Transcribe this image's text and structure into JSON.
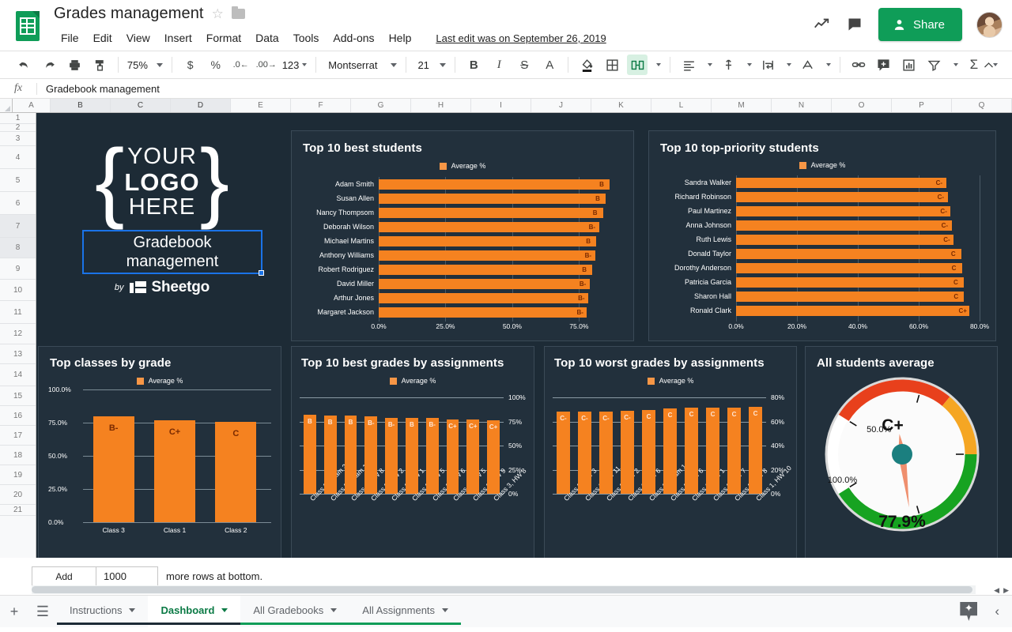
{
  "app": {
    "doc_title": "Grades management",
    "last_edit": "Last edit was on September 26, 2019",
    "share_label": "Share",
    "menus": [
      "File",
      "Edit",
      "View",
      "Insert",
      "Format",
      "Data",
      "Tools",
      "Add-ons",
      "Help"
    ],
    "icons": {
      "logo": "sheets-logo-icon",
      "star": "star-icon",
      "folder": "move-to-folder-icon",
      "activity": "activity-trend-icon",
      "comments": "comments-icon",
      "share_person": "person-add-icon",
      "avatar": "user-avatar"
    }
  },
  "toolbar": {
    "zoom": "75%",
    "font": "Montserrat",
    "font_size": "21",
    "number_format": "123",
    "buttons": [
      "undo-icon",
      "redo-icon",
      "print-icon",
      "paint-format-icon",
      "currency-icon",
      "percent-icon",
      "decrease-decimal-icon",
      "increase-decimal-icon",
      "bold-icon",
      "italic-icon",
      "strikethrough-icon",
      "text-color-icon",
      "fill-color-icon",
      "borders-icon",
      "merge-cells-icon",
      "horizontal-align-icon",
      "vertical-align-icon",
      "text-wrap-icon",
      "text-rotation-icon",
      "insert-link-icon",
      "insert-comment-icon",
      "insert-chart-icon",
      "filter-icon",
      "functions-icon",
      "collapse-toolbar-icon"
    ]
  },
  "formula_bar": {
    "fx_label": "fx",
    "value": "Gradebook management"
  },
  "grid": {
    "columns": [
      "A",
      "B",
      "C",
      "D",
      "E",
      "F",
      "G",
      "H",
      "I",
      "J",
      "K",
      "L",
      "M",
      "N",
      "O",
      "P",
      "Q"
    ],
    "selected_columns": [
      "B",
      "C",
      "D"
    ],
    "rows": [
      "1",
      "2",
      "3",
      "4",
      "5",
      "6",
      "7",
      "8",
      "9",
      "10",
      "11",
      "12",
      "13",
      "14",
      "15",
      "16",
      "17",
      "18",
      "19",
      "20",
      "21"
    ],
    "selected_rows": [
      "7",
      "8"
    ]
  },
  "logo_block": {
    "brace_left": "{",
    "brace_right": "}",
    "line1": "YOUR",
    "line2": "LOGO",
    "line3": "HERE",
    "selected_cell_text": "Gradebook\nmanagement",
    "selected_cell_line1": "Gradebook",
    "selected_cell_line2": "management",
    "by_label": "by",
    "brand": "Sheetgo"
  },
  "colors": {
    "bar": "#f58220",
    "bar_label": "#7a2a00",
    "panel_bg": "#22303c",
    "canvas_bg": "#1d2b36",
    "accent_green": "#0F9D58",
    "selection_blue": "#1a73e8",
    "gauge_red": "#e8401c",
    "gauge_orange": "#f5a623",
    "gauge_green": "#17a321",
    "gauge_needle": "#ef8f6e",
    "gauge_hub": "#1b7f7f"
  },
  "chart_data": [
    {
      "type": "bar",
      "orientation": "horizontal",
      "title": "Top 10 best students",
      "legend": [
        "Average %"
      ],
      "legend_position": "top",
      "categories": [
        "Adam Smith",
        "Susan Allen",
        "Nancy Thompsom",
        "Deborah Wilson",
        "Michael Martins",
        "Anthony Williams",
        "Robert Rodriguez",
        "David Miller",
        "Arthur Jones",
        "Margaret Jackson"
      ],
      "values": [
        86.5,
        85.0,
        84.0,
        82.5,
        81.5,
        81.0,
        80.0,
        79.0,
        78.5,
        78.0
      ],
      "data_labels": [
        "B",
        "B",
        "B",
        "B-",
        "B",
        "B-",
        "B",
        "B-",
        "B-",
        "B-"
      ],
      "xlabel": "",
      "ylabel": "",
      "xlim": [
        0,
        90
      ],
      "xticks": [
        "0.0%",
        "25.0%",
        "50.0%",
        "75.0%"
      ],
      "xtick_values": [
        0,
        25,
        50,
        75
      ],
      "grid": true
    },
    {
      "type": "bar",
      "orientation": "horizontal",
      "title": "Top 10 top-priority students",
      "legend": [
        "Average %"
      ],
      "legend_position": "top",
      "categories": [
        "Sandra Walker",
        "Richard Robinson",
        "Paul Martinez",
        "Anna Johnson",
        "Ruth Lewis",
        "Donald Taylor",
        "Dorothy Anderson",
        "Patricia Garcia",
        "Sharon Hall",
        "Ronald Clark"
      ],
      "values": [
        69.0,
        69.5,
        70.5,
        70.8,
        71.5,
        74.0,
        74.2,
        74.8,
        74.9,
        76.5
      ],
      "data_labels": [
        "C-",
        "C-",
        "C-",
        "C-",
        "C-",
        "C",
        "C",
        "C",
        "C",
        "C+"
      ],
      "xlabel": "",
      "ylabel": "",
      "xlim": [
        0,
        80
      ],
      "xticks": [
        "0.0%",
        "20.0%",
        "40.0%",
        "60.0%",
        "80.0%"
      ],
      "xtick_values": [
        0,
        20,
        40,
        60,
        80
      ],
      "grid": true
    },
    {
      "type": "bar",
      "orientation": "vertical",
      "title": "Top classes by grade",
      "legend": [
        "Average %"
      ],
      "legend_position": "top",
      "categories": [
        "Class 3",
        "Class 1",
        "Class 2"
      ],
      "values": [
        80.0,
        77.0,
        75.5
      ],
      "data_labels": [
        "B-",
        "C+",
        "C"
      ],
      "xlabel": "",
      "ylabel": "",
      "ylim": [
        0,
        100
      ],
      "yticks": [
        "0.0%",
        "25.0%",
        "50.0%",
        "75.0%",
        "100.0%"
      ],
      "ytick_values": [
        0,
        25,
        50,
        75,
        100
      ],
      "grid": true
    },
    {
      "type": "bar",
      "orientation": "vertical",
      "title": "Top 10 best grades by assignments",
      "legend": [
        "Average %"
      ],
      "legend_position": "top",
      "categories": [
        "Class 3, Exam 2",
        "Class 3, Exam 1",
        "Class 1, HW 8",
        "Class 3, HW 2",
        "Class 3, HW 1",
        "Class 3, HW 5",
        "Class 3, HW 6",
        "Class 1, HW 5",
        "Class 3, HW 9",
        "Class 3, HW 8"
      ],
      "values": [
        82.0,
        81.0,
        81.0,
        80.0,
        79.0,
        79.0,
        78.5,
        77.0,
        77.0,
        76.5
      ],
      "data_labels": [
        "B",
        "B",
        "B",
        "B-",
        "B-",
        "B",
        "B-",
        "C+",
        "C+",
        "C+"
      ],
      "xlabel": "",
      "ylabel": "",
      "ylim": [
        0,
        100
      ],
      "yticks": [
        "0%",
        "25%",
        "50%",
        "75%",
        "100%"
      ],
      "ytick_values": [
        0,
        25,
        50,
        75,
        100
      ],
      "grid": true
    },
    {
      "type": "bar",
      "orientation": "vertical",
      "title": "Top 10 worst grades by assignments",
      "legend": [
        "Average %"
      ],
      "legend_position": "top",
      "categories": [
        "Class 2, HW 3",
        "Class 1, HW 11",
        "Class 2, HW 2",
        "Class 1, HW 6",
        "Class 2, Exam 1",
        "Class 2, HW 6",
        "Class 1, HW 1",
        "Class 2, HW 7",
        "Class 2, HW 8",
        "Class 1, HW 10"
      ],
      "values": [
        68.0,
        68.2,
        68.5,
        68.8,
        69.5,
        71.0,
        71.2,
        71.5,
        71.8,
        72.0
      ],
      "data_labels": [
        "C-",
        "C-",
        "C-",
        "C-",
        "C",
        "C",
        "C",
        "C",
        "C",
        "C"
      ],
      "xlabel": "",
      "ylabel": "",
      "ylim": [
        0,
        80
      ],
      "yticks": [
        "0%",
        "20%",
        "40%",
        "60%",
        "80%"
      ],
      "ytick_values": [
        0,
        20,
        40,
        60,
        80
      ],
      "grid": true
    },
    {
      "type": "gauge",
      "title": "All students average",
      "value": 77.9,
      "value_label": "77.9%",
      "grade_label": "C+",
      "min": 0,
      "max": 100,
      "tick_labels": [
        "50.0%",
        "100.0%"
      ],
      "bands": [
        {
          "from": 0,
          "to": 33,
          "color": "#e8401c"
        },
        {
          "from": 33,
          "to": 50,
          "color": "#f5a623"
        },
        {
          "from": 50,
          "to": 100,
          "color": "#17a321"
        }
      ]
    }
  ],
  "add_rows": {
    "button_label": "Add",
    "count": "1000",
    "suffix_text": "more rows at bottom."
  },
  "sheet_tabs": {
    "add_icon": "add-sheet-icon",
    "all_sheets_icon": "all-sheets-icon",
    "tabs": [
      {
        "label": "Instructions",
        "active": false,
        "underline": "#1d2b36"
      },
      {
        "label": "Dashboard",
        "active": true,
        "underline": "#1d2b36"
      },
      {
        "label": "All Gradebooks",
        "active": false,
        "underline": "#0F9D58"
      },
      {
        "label": "All Assignments",
        "active": false,
        "underline": "#0F9D58"
      }
    ],
    "explore_icon": "explore-icon",
    "collapse_icon": "chevron-left-icon"
  }
}
